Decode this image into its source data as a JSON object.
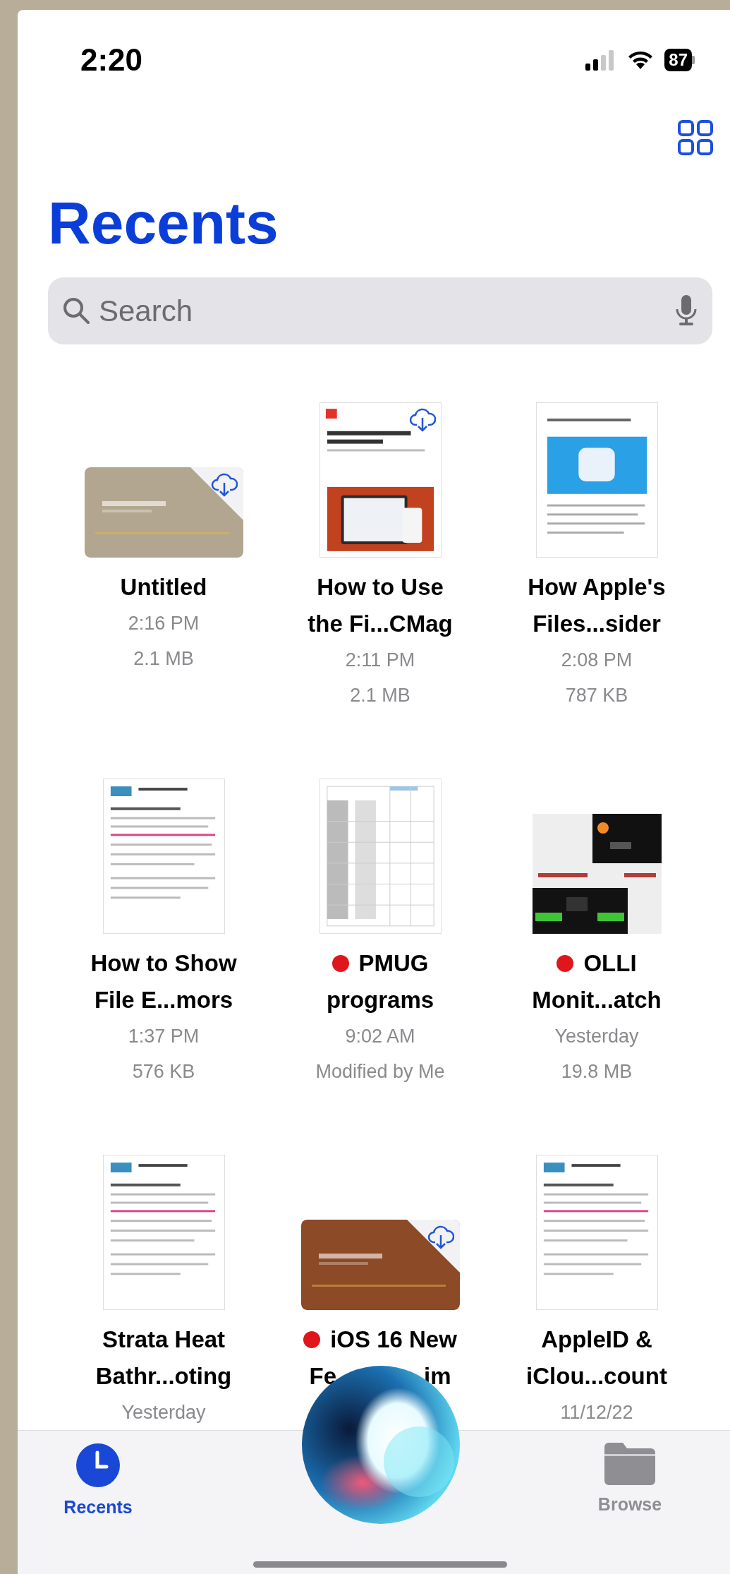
{
  "status_bar": {
    "time": "2:20",
    "battery": "87"
  },
  "title": "Recents",
  "search": {
    "placeholder": "Search"
  },
  "files": [
    {
      "name_lines": [
        [
          "Untitled"
        ]
      ],
      "meta": [
        "2:16 PM",
        "2.1 MB"
      ],
      "preview": {
        "kind": "card"
      },
      "cloud": true
    },
    {
      "name_lines": [
        [
          "How to Use"
        ],
        [
          "the Fi...CMag"
        ]
      ],
      "meta": [
        "2:11 PM",
        "2.1 MB"
      ],
      "preview": {
        "kind": "article"
      },
      "cloud": true
    },
    {
      "name_lines": [
        [
          "How Apple's"
        ],
        [
          "Files...sider"
        ]
      ],
      "meta": [
        "2:08 PM",
        "787 KB"
      ],
      "preview": {
        "kind": "page"
      },
      "cloud": false
    },
    {
      "name_lines": [
        [
          "How to Show"
        ],
        [
          "File E...mors"
        ]
      ],
      "meta": [
        "1:37 PM",
        "576 KB"
      ],
      "preview": {
        "kind": "document"
      },
      "cloud": false
    },
    {
      "name_lines": [
        [
          "PMUG"
        ],
        [
          "programs"
        ]
      ],
      "meta": [
        "9:02 AM",
        "Modified by Me"
      ],
      "preview": {
        "kind": "sheet"
      },
      "cloud": false,
      "color": "#e0161d"
    },
    {
      "name_lines": [
        [
          "OLLI"
        ],
        [
          "Monit...atch"
        ]
      ],
      "meta": [
        "Yesterday",
        "19.8 MB"
      ],
      "preview": {
        "kind": "collage"
      },
      "cloud": false,
      "color": "#e0161d"
    },
    {
      "name_lines": [
        [
          "Strata Heat"
        ],
        [
          "Bathr...oting"
        ]
      ],
      "meta": [
        "Yesterday"
      ],
      "preview": {
        "kind": "document"
      },
      "cloud": false
    },
    {
      "name_lines": [
        [
          "iOS 16 New"
        ],
        [
          "Fe",
          "im"
        ]
      ],
      "preview": {
        "kind": "banner"
      },
      "cloud": true,
      "color": "#e0161d"
    },
    {
      "name_lines": [
        [
          "AppleID &"
        ],
        [
          "iClou...count"
        ]
      ],
      "meta": [
        "11/12/22"
      ],
      "preview": {
        "kind": "document"
      },
      "cloud": false
    }
  ],
  "tabs": [
    {
      "label": "Recents",
      "selected": true
    },
    {
      "label": "Browse",
      "selected": false
    }
  ]
}
